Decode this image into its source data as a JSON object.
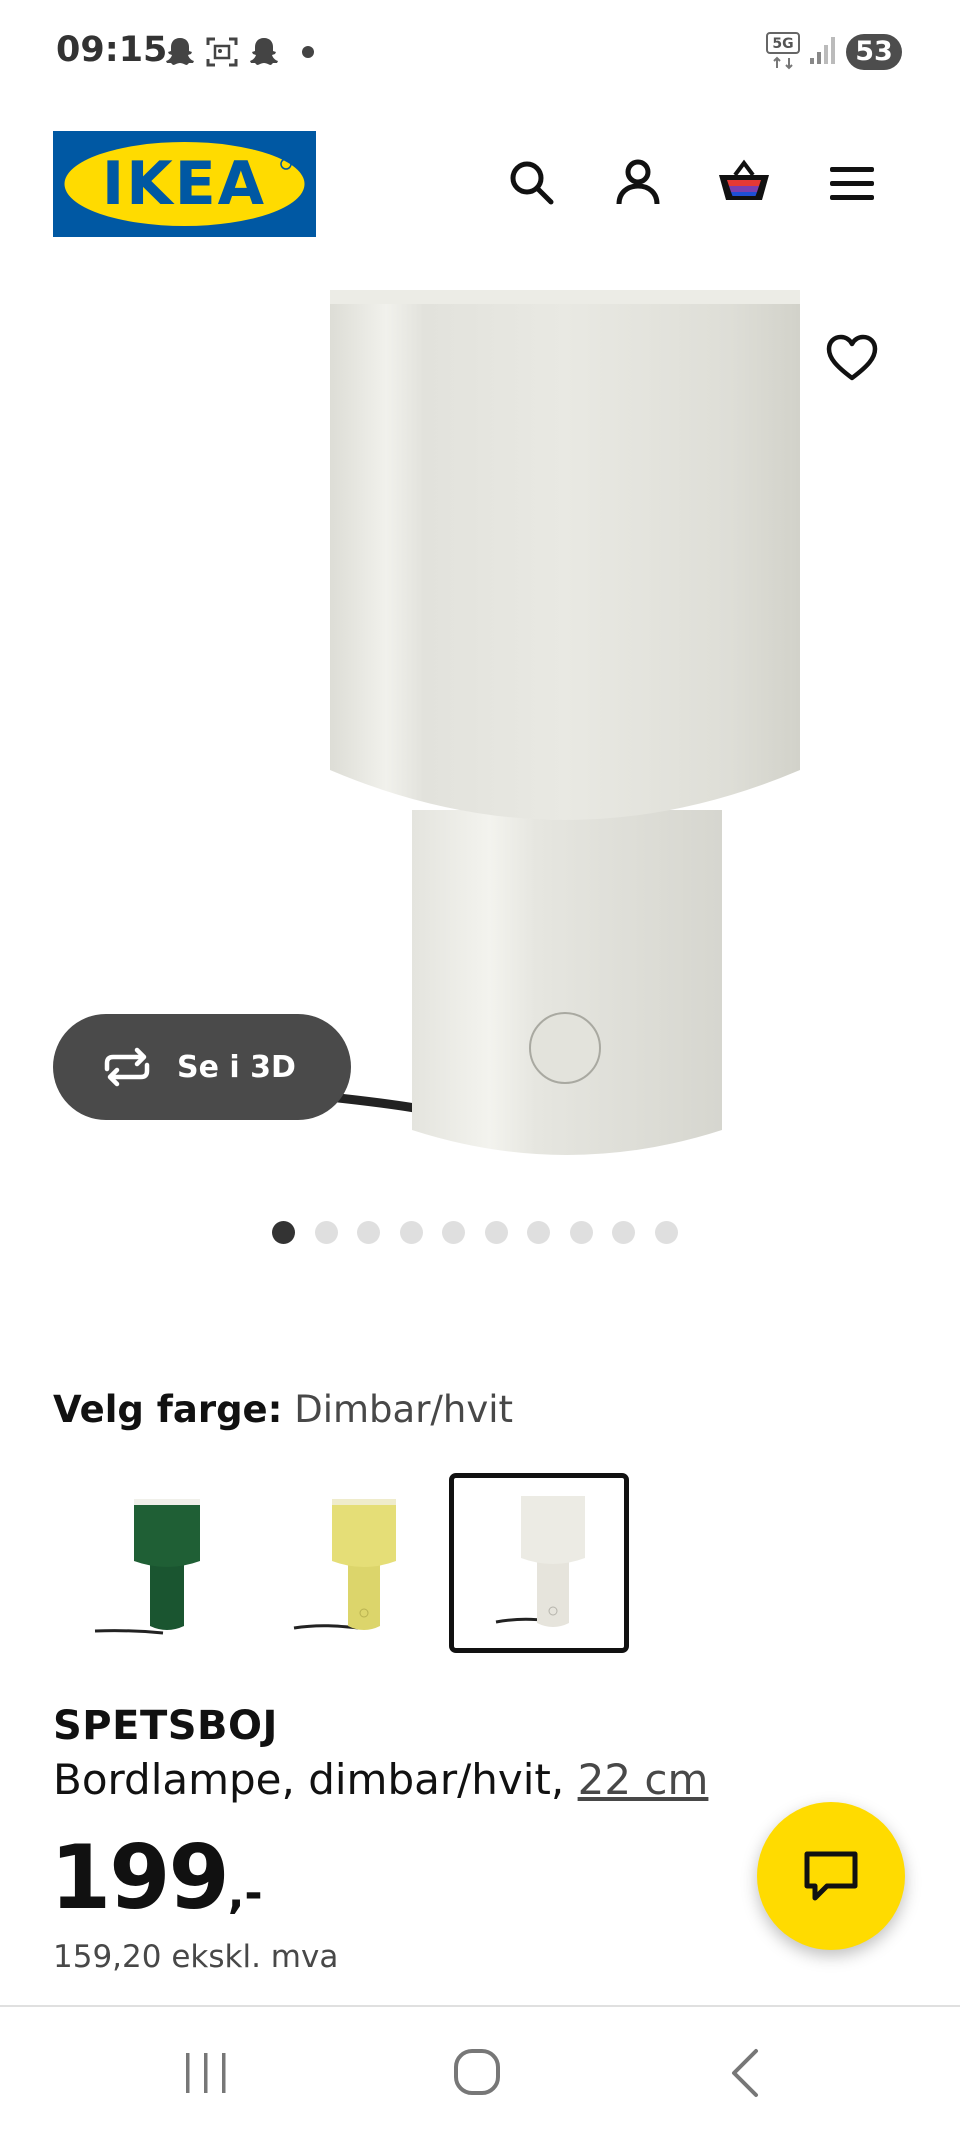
{
  "status_bar": {
    "time": "09:15",
    "notification_icons": [
      "snapchat-icon",
      "screenshot-icon",
      "snapchat-icon"
    ],
    "network": "5G",
    "battery": "53"
  },
  "header": {
    "logo_text": "IKEA",
    "icons": [
      "search-icon",
      "account-icon",
      "cart-icon",
      "menu-icon"
    ],
    "brand_colors": {
      "blue": "#0058a3",
      "yellow": "#ffdb00"
    }
  },
  "gallery": {
    "view_3d_label": "Se i 3D",
    "image_count": 10,
    "active_index": 0
  },
  "color_selector": {
    "label": "Velg farge:",
    "selected_value": "Dimbar/hvit",
    "swatches": [
      {
        "color": "#1f5a32",
        "selected": false
      },
      {
        "color": "#e3dc74",
        "selected": false
      },
      {
        "color": "#e6e3da",
        "selected": true
      }
    ]
  },
  "product": {
    "name": "SPETSBOJ",
    "description": "Bordlampe, dimbar/hvit, ",
    "size": "22 cm",
    "price": "199",
    "price_suffix": ",-",
    "price_ex_vat": "159,20 ekskl. mva"
  },
  "nav_bar": {
    "buttons": [
      "recent-apps-icon",
      "home-icon",
      "back-icon"
    ]
  }
}
